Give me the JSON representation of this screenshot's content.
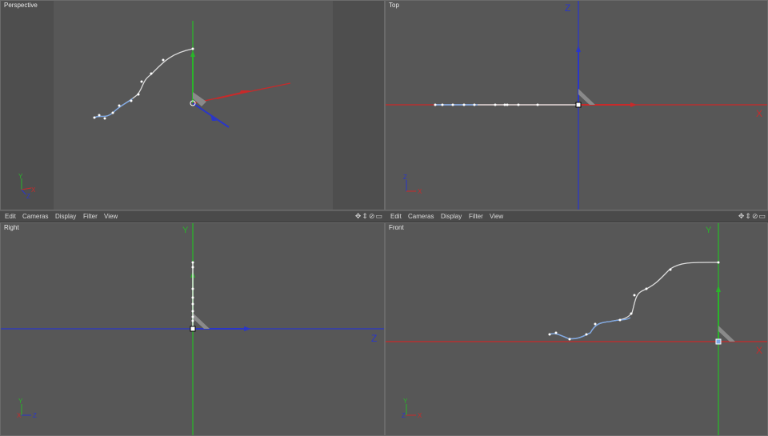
{
  "viewports": {
    "perspective": {
      "title": "Perspective"
    },
    "top": {
      "title": "Top"
    },
    "right": {
      "title": "Right"
    },
    "front": {
      "title": "Front"
    }
  },
  "menus": [
    "Edit",
    "Cameras",
    "Display",
    "Filter",
    "View"
  ],
  "nav_icons": {
    "move": "✥",
    "zoom": "⇕",
    "rotate": "⊘",
    "maximize": "▭"
  },
  "axes": {
    "x": "X",
    "y": "Y",
    "z": "Z"
  },
  "colors": {
    "viewport_bg": "#575757",
    "x_axis": "#c82a2a",
    "y_axis": "#2ab42a",
    "z_axis": "#2a36c8",
    "spline": "#dcdcdc",
    "spline_selected": "#7ba7e6"
  }
}
